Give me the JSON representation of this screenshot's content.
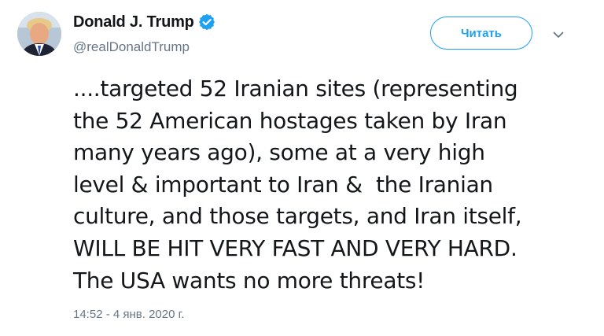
{
  "author": {
    "display_name": "Donald J. Trump",
    "handle": "@realDonaldTrump",
    "verified": true,
    "avatar_icon": "profile-photo"
  },
  "actions": {
    "follow_label": "Читать",
    "more_icon": "chevron-down-icon"
  },
  "tweet": {
    "lines": [
      "....targeted 52 Iranian sites (representing",
      "the 52 American hostages taken by Iran",
      "many years ago), some at a very high",
      "level & important to Iran &  the Iranian",
      "culture, and those targets, and Iran itself,",
      "WILL BE HIT VERY FAST AND VERY HARD.",
      "The USA wants no more threats!"
    ],
    "timestamp": "14:52 - 4 янв. 2020 г."
  },
  "colors": {
    "accent": "#1da1f2",
    "text": "#14171a",
    "muted": "#657786"
  }
}
